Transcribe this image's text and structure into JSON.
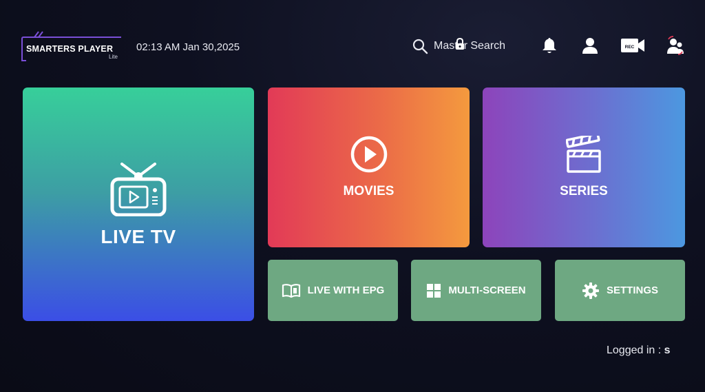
{
  "app": {
    "name": "SMARTERS PLAYER",
    "edition": "Lite"
  },
  "header": {
    "datetime": "02:13 AM  Jan 30,2025",
    "search_label": "Master Search",
    "icons": [
      "search-icon",
      "lock-icon",
      "bell-icon",
      "user-icon",
      "recording-icon",
      "switch-user-icon"
    ]
  },
  "tiles": {
    "live_tv": {
      "label": "LIVE TV",
      "icon": "tv-icon"
    },
    "movies": {
      "label": "MOVIES",
      "icon": "play-circle-icon"
    },
    "series": {
      "label": "SERIES",
      "icon": "clapperboard-icon"
    },
    "live_epg": {
      "label": "LIVE WITH EPG",
      "icon": "book-icon"
    },
    "multi_screen": {
      "label": "MULTI-SCREEN",
      "icon": "grid-icon"
    },
    "settings": {
      "label": "SETTINGS",
      "icon": "gear-icon"
    }
  },
  "footer": {
    "logged_in_label": "Logged in : ",
    "username": "s"
  },
  "colors": {
    "background": "#0d0f1c",
    "small_tile": "#6ea882",
    "accent_purple": "#7b4fd8"
  }
}
